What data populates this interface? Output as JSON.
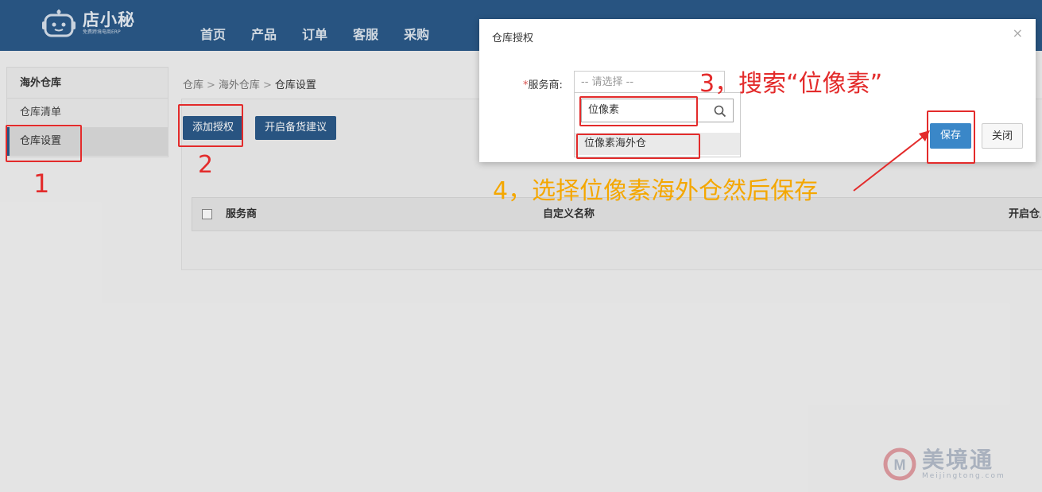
{
  "header": {
    "logo_text": "店小秘",
    "logo_subtitle": "免费跨境电商ERP",
    "nav": [
      "首页",
      "产品",
      "订单",
      "客服",
      "采购"
    ]
  },
  "sidebar": {
    "heading": "海外仓库",
    "items": [
      {
        "label": "仓库清单"
      },
      {
        "label": "仓库设置"
      }
    ]
  },
  "breadcrumb": {
    "items": [
      "仓库",
      "海外仓库",
      "仓库设置"
    ],
    "separator": ">"
  },
  "toolbar": {
    "add_label": "添加授权",
    "suggest_label": "开启备货建议"
  },
  "table": {
    "headers": [
      "服务商",
      "自定义名称",
      "开启仓库"
    ]
  },
  "modal": {
    "title": "仓库授权",
    "close_symbol": "×",
    "field_label": "服务商:",
    "required_mark": "*",
    "select_placeholder": "-- 请选择 --",
    "search_value": "位像素",
    "option": "位像素海外仓",
    "save_label": "保存",
    "close_label": "关闭"
  },
  "annotations": {
    "step1": "1",
    "step2": "2",
    "step3": "3，搜索“位像素”",
    "step4": "4，选择位像素海外仓然后保存",
    "red_color": "#e32b2b",
    "orange_color": "#f4a700"
  },
  "watermark": {
    "brand": "美境通",
    "url": "Meijingtong.com"
  },
  "icons": {
    "logo": "robot-icon",
    "search": "search-icon",
    "dropdown": "chevron-down-icon",
    "close": "close-icon"
  },
  "colors": {
    "header_bg": "#2b5a8a",
    "primary_button": "#3a87c8"
  }
}
